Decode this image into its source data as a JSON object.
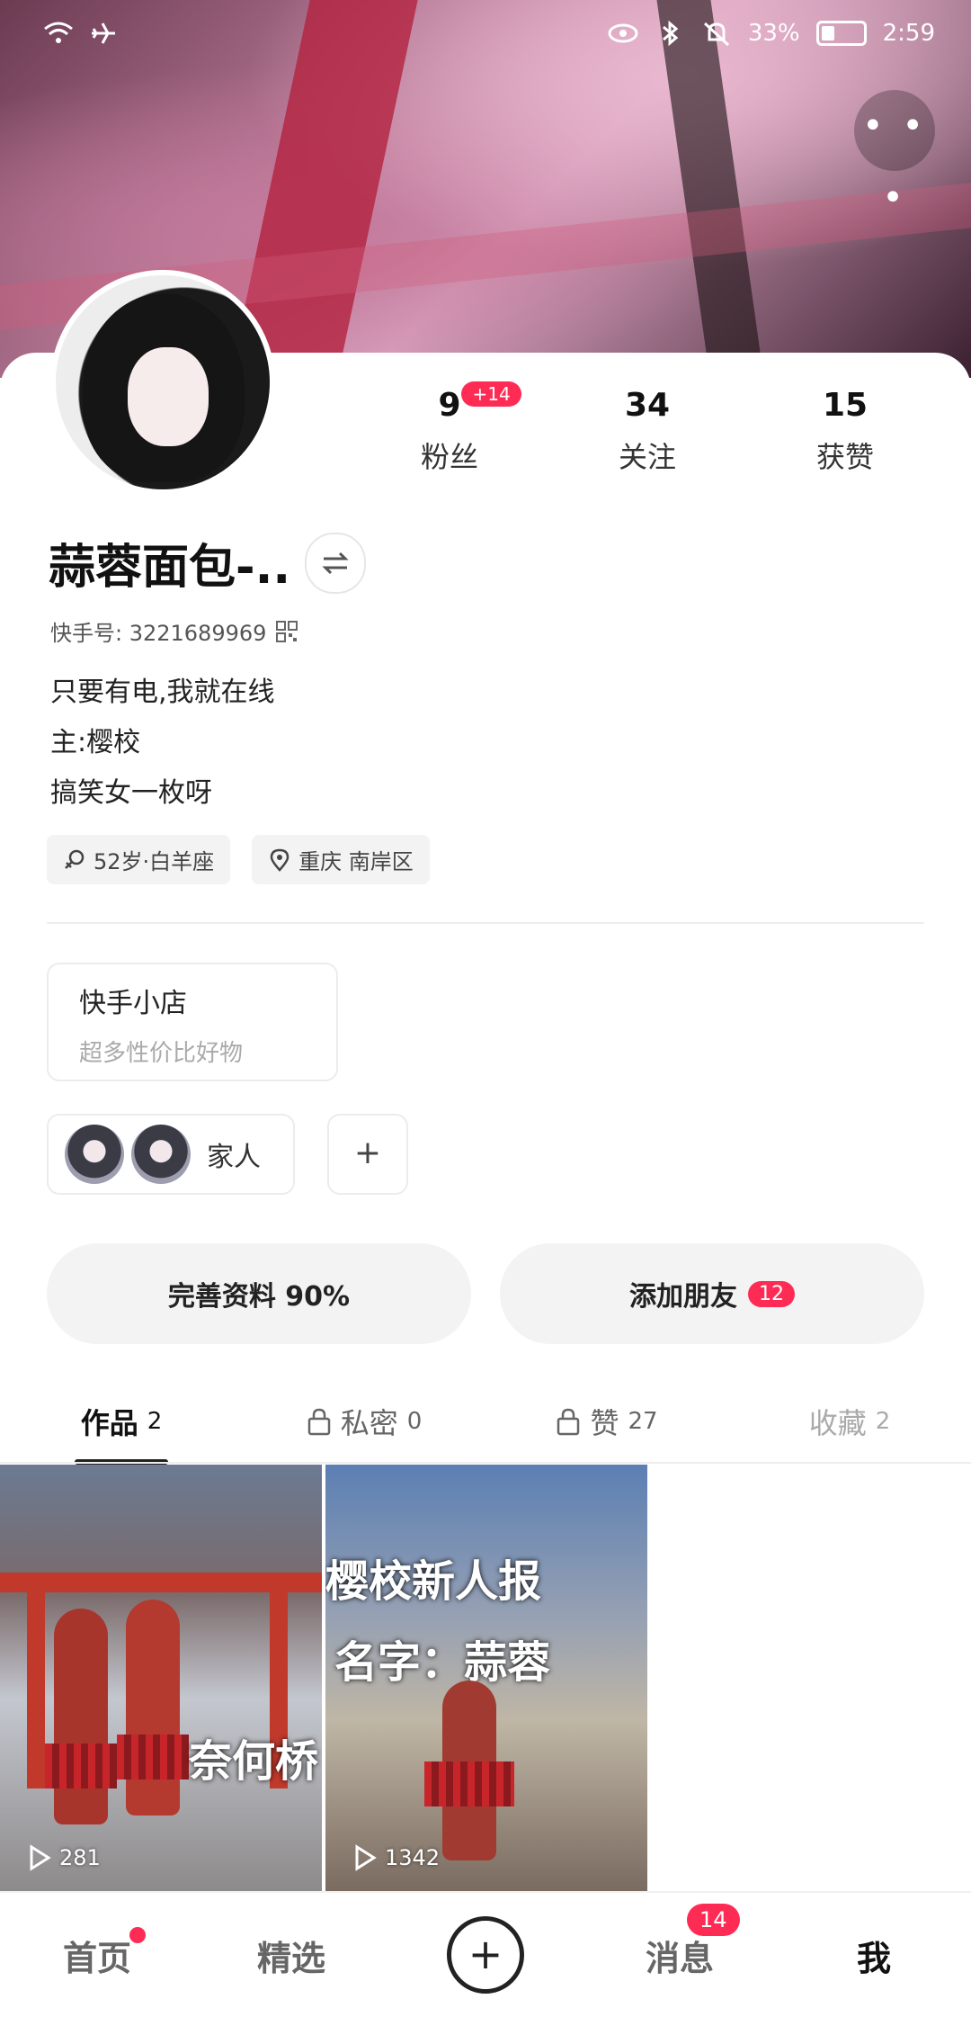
{
  "status_bar": {
    "battery": "33%",
    "time": "2:59"
  },
  "header": {
    "more_label": "• • •"
  },
  "profile": {
    "name": "蒜蓉面包-..",
    "uid_label": "快手号: 3221689969",
    "bio": [
      "只要有电,我就在线",
      "主:樱校",
      "搞笑女一枚呀"
    ],
    "tags": [
      {
        "icon": "gender-female-icon",
        "text": "52岁·白羊座"
      },
      {
        "icon": "location-pin-icon",
        "text": "重庆 南岸区"
      }
    ]
  },
  "stats": [
    {
      "value": "9",
      "label": "粉丝",
      "badge": "+14"
    },
    {
      "value": "34",
      "label": "关注"
    },
    {
      "value": "15",
      "label": "获赞"
    }
  ],
  "shop": {
    "title": "快手小店",
    "subtitle": "超多性价比好物"
  },
  "family": {
    "label": "家人",
    "add_label": "+"
  },
  "actions": {
    "complete_profile": "完善资料 90%",
    "add_friends": "添加朋友",
    "add_friends_count": "12"
  },
  "tabs": [
    {
      "label": "作品",
      "count": "2",
      "active": true
    },
    {
      "label": "私密",
      "count": "0",
      "locked": true
    },
    {
      "label": "赞",
      "count": "27",
      "locked": true
    },
    {
      "label": "收藏",
      "count": "2"
    }
  ],
  "videos": [
    {
      "overlay_text": "奈何桥",
      "plays": "281"
    },
    {
      "overlay_line1": "樱校新人报",
      "overlay_line2": "名字：蒜蓉",
      "plays": "1342"
    }
  ],
  "bottom_nav": [
    {
      "label": "首页",
      "dot": true
    },
    {
      "label": "精选"
    },
    {
      "label": "+",
      "icon": "plus-circle-icon"
    },
    {
      "label": "消息",
      "badge": "14"
    },
    {
      "label": "我",
      "active": true
    }
  ],
  "colors": {
    "accent": "#fe2c55",
    "text": "#222222",
    "muted": "#aaaaaa"
  }
}
